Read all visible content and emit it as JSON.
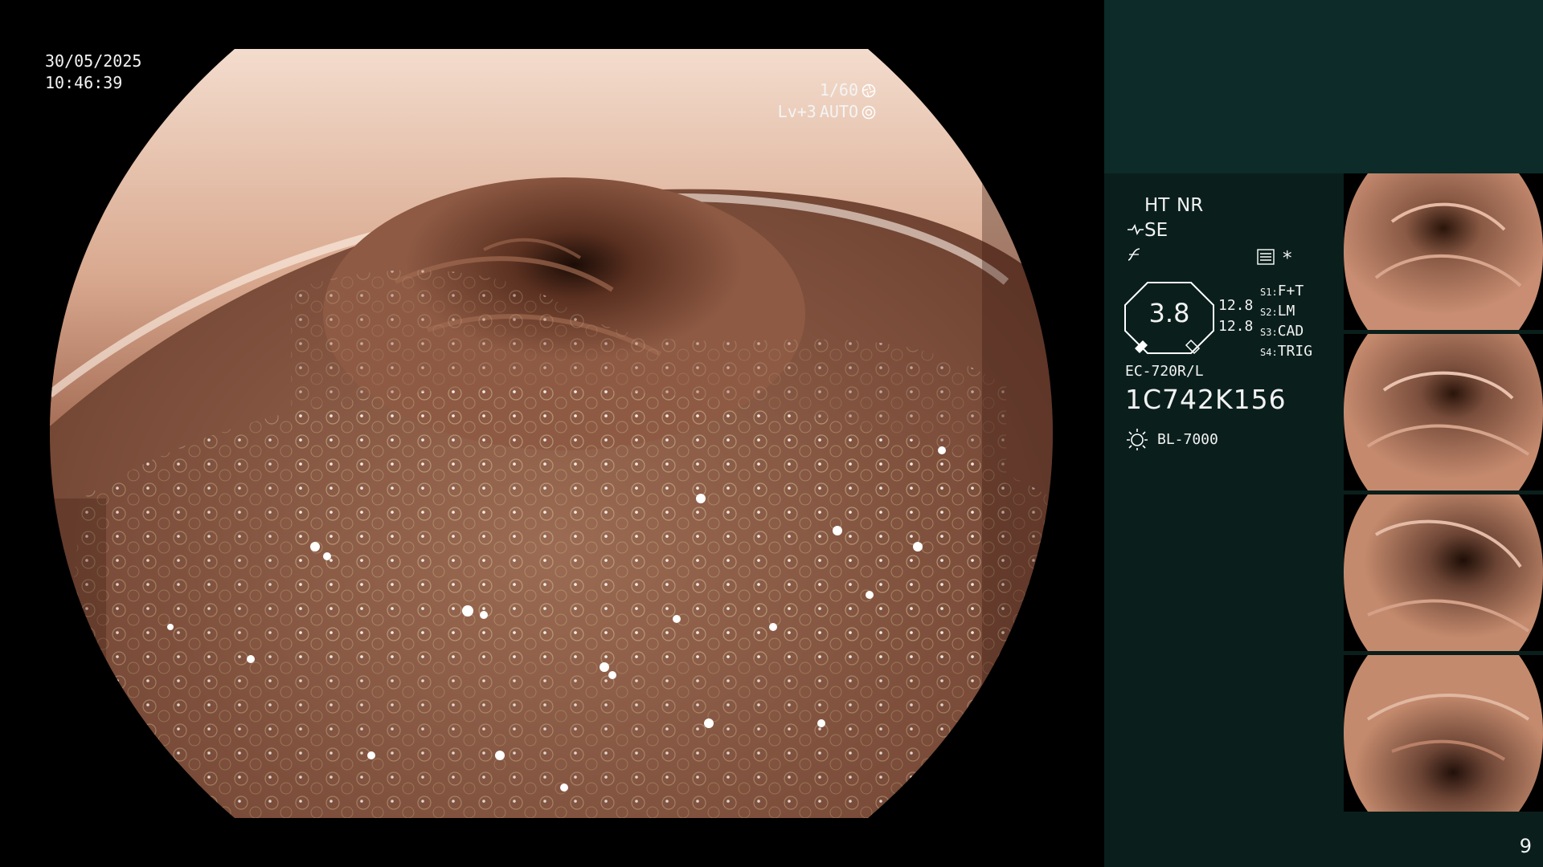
{
  "overlay": {
    "date": "30/05/2025",
    "time": "10:46:39",
    "shutter": "1/60",
    "level": "Lv+3",
    "mode": "AUTO"
  },
  "panel": {
    "ht": "HT",
    "nr": "NR",
    "se": "SE",
    "asterisk": "*",
    "zoom": "3.8",
    "values": [
      "12.8",
      "12.8"
    ],
    "switches": [
      {
        "key": "S1",
        "value": "F+T"
      },
      {
        "key": "S2",
        "value": "LM"
      },
      {
        "key": "S3",
        "value": "CAD"
      },
      {
        "key": "S4",
        "value": "TRIG"
      }
    ],
    "scope_model": "EC-720R/L",
    "scope_serial": "1C742K156",
    "light_source": "BL-7000",
    "frame_count": "9"
  },
  "icons": [
    "shutter-icon",
    "auto-iris-icon",
    "scope-se-icon",
    "curve-icon",
    "list-icon",
    "lamp-icon"
  ],
  "colors": {
    "panel_bg": "#0a1f1c",
    "panel_top": "#0d2b28",
    "highlight": "#e6b53a",
    "mucosa": "#b87a62"
  },
  "thumbnails": [
    {
      "label": "thumbnail-1"
    },
    {
      "label": "thumbnail-2"
    },
    {
      "label": "thumbnail-3"
    },
    {
      "label": "thumbnail-4"
    }
  ]
}
